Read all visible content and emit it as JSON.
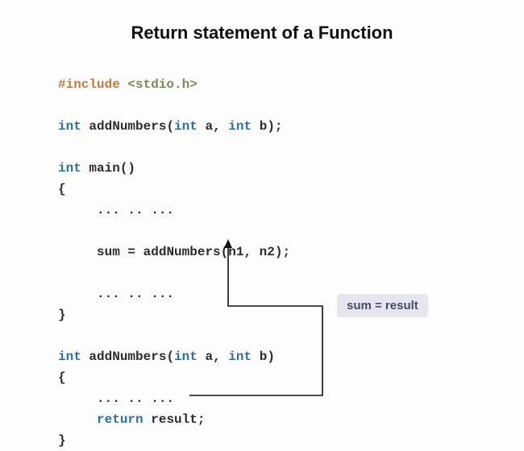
{
  "title": "Return statement of a Function",
  "code": {
    "l1_pp": "#include",
    "l1_inc": "<stdio.h>",
    "l2_kw1": "int",
    "l2_fn": "addNumbers",
    "l2_kw2": "int",
    "l2_a": "a",
    "l2_kw3": "int",
    "l2_b": "b",
    "l3_kw": "int",
    "l3_fn": "main",
    "brace_open": "{",
    "brace_close": "}",
    "dots": "... .. ...",
    "call_lhs": "sum",
    "call_fn": "addNumbers",
    "call_arg1": "n1",
    "call_arg2": "n2",
    "def_kw1": "int",
    "def_fn": "addNumbers",
    "def_kw2": "int",
    "def_a": "a",
    "def_kw3": "int",
    "def_b": "b",
    "return_kw": "return",
    "return_val": "result"
  },
  "callout": "sum = result"
}
